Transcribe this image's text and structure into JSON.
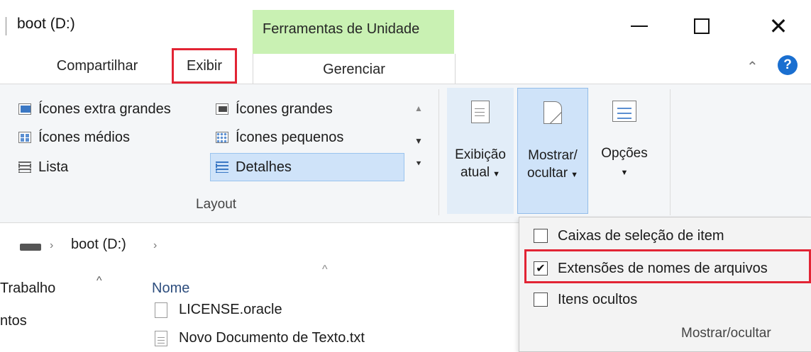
{
  "window": {
    "title": "boot (D:)",
    "contextual_tab_group": "Ferramentas de Unidade",
    "controls": {
      "minimize": "—",
      "maximize": "☐",
      "close": "✕"
    }
  },
  "tabs": {
    "compartilhar": "Compartilhar",
    "exibir": "Exibir",
    "gerenciar": "Gerenciar"
  },
  "help_icon": "?",
  "layout_group": {
    "label": "Layout",
    "items": [
      "Ícones extra grandes",
      "Ícones grandes",
      "Ícones médios",
      "Ícones pequenos",
      "Lista",
      "Detalhes"
    ],
    "selected": "Detalhes"
  },
  "ribbon_buttons": {
    "exibicao_atual": {
      "line1": "Exibição",
      "line2": "atual"
    },
    "mostrar_ocultar": {
      "line1": "Mostrar/",
      "line2": "ocultar"
    },
    "opcoes": {
      "line1": "Opções"
    }
  },
  "address_bar": {
    "path": "boot (D:)"
  },
  "nav_pane": [
    "Trabalho",
    "ntos"
  ],
  "file_list": {
    "column_name": "Nome",
    "files": [
      "LICENSE.oracle",
      "Novo Documento de Texto.txt"
    ]
  },
  "show_hide_menu": {
    "items": [
      {
        "label": "Caixas de seleção de item",
        "checked": false
      },
      {
        "label": "Extensões de nomes de arquivos",
        "checked": true
      },
      {
        "label": "Itens ocultos",
        "checked": false
      }
    ],
    "footer": "Mostrar/ocultar"
  },
  "colors": {
    "highlight_box": "#e22434",
    "contextual_tab": "#c9f1b3",
    "selection": "#cfe3f9",
    "help_icon": "#1a6fd0"
  }
}
